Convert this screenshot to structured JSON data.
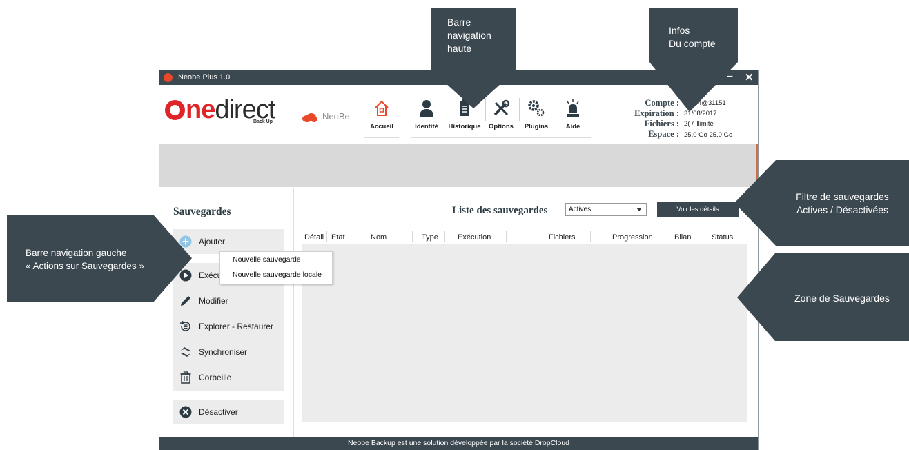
{
  "window": {
    "title": "Neobe Plus 1.0",
    "minimize": "–",
    "close": "✕"
  },
  "brand": {
    "logo_one": "ne",
    "logo_direct": "direct",
    "logo_sub": "Back Up",
    "neobe": "NeoBe"
  },
  "nav": [
    {
      "label": "Accueil",
      "icon": "home-icon"
    },
    {
      "label": "Identité",
      "icon": "person-icon"
    },
    {
      "label": "Historique",
      "icon": "clipboard-icon"
    },
    {
      "label": "Options",
      "icon": "tools-icon"
    },
    {
      "label": "Plugins",
      "icon": "gears-icon"
    },
    {
      "label": "Aide",
      "icon": "alarm-light-icon"
    }
  ],
  "account": {
    "compte_label": "Compte :",
    "compte_value": "1…44@31151",
    "expiration_label": "Expiration :",
    "expiration_value": "31/08/2017",
    "fichiers_label": "Fichiers :",
    "fichiers_value": "2( / illimité",
    "espace_label": "Espace :",
    "espace_value": "25,0 Go 25,0 Go"
  },
  "sidebar": {
    "title": "Sauvegardes",
    "items": [
      {
        "label": "Ajouter",
        "icon": "plus-circle-icon"
      },
      {
        "label": "Exécuter",
        "icon": "play-circle-icon"
      },
      {
        "label": "Modifier",
        "icon": "pencil-icon"
      },
      {
        "label": "Explorer - Restaurer",
        "icon": "restore-icon"
      },
      {
        "label": "Synchroniser",
        "icon": "sync-icon"
      },
      {
        "label": "Corbeille",
        "icon": "trash-icon"
      },
      {
        "label": "Désactiver",
        "icon": "x-circle-icon"
      }
    ]
  },
  "popup": {
    "items": [
      "Nouvelle sauvegarde",
      "Nouvelle sauvegarde locale"
    ]
  },
  "main": {
    "title": "Liste des sauvegardes",
    "filter_value": "Actives",
    "details_button": "Voir les détails",
    "columns": [
      "Détail",
      "Etat",
      "Nom",
      "Type",
      "Exécution",
      "Fichiers",
      "Progression",
      "Bilan",
      "Status"
    ]
  },
  "footer": "Neobe Backup est une solution développée par la société DropCloud",
  "callouts": {
    "top_nav": [
      "Barre",
      "navigation",
      "haute"
    ],
    "account_info": [
      "Infos",
      "Du compte"
    ],
    "left_nav": [
      "Barre navigation gauche",
      "« Actions sur Sauvegardes »"
    ],
    "filter": [
      "Filtre de sauvegardes",
      "Actives / Désactivées"
    ],
    "zone": [
      "Zone de Sauvegardes"
    ]
  },
  "colors": {
    "dark": "#3c4850",
    "brand_red": "#e0252a",
    "accent_orange": "#e8492a",
    "panel_gray": "#ececec"
  }
}
